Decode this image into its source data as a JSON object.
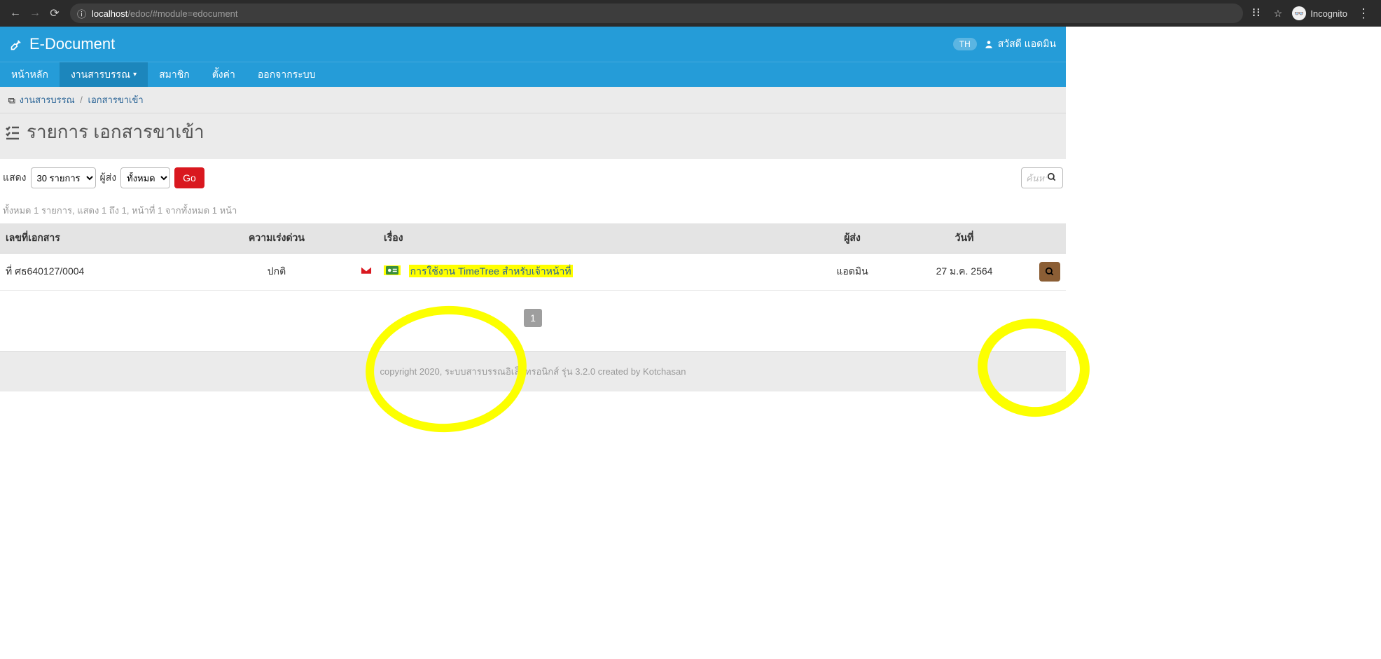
{
  "browser": {
    "url_domain": "localhost",
    "url_path": "/edoc/#module=edocument",
    "incognito_label": "Incognito"
  },
  "topbar": {
    "brand": "E-Document",
    "lang": "TH",
    "greeting": "สวัสดี แอดมิน"
  },
  "nav": {
    "home": "หน้าหลัก",
    "docs": "งานสารบรรณ",
    "member": "สมาชิก",
    "settings": "ตั้งค่า",
    "logout": "ออกจากระบบ"
  },
  "breadcrumb": {
    "a": "งานสารบรรณ",
    "b": "เอกสารขาเข้า"
  },
  "page_title": "รายการ เอกสารขาเข้า",
  "toolbar": {
    "show_label": "แสดง",
    "show_value": "30 รายการ",
    "send_label": "ผู้ส่ง",
    "send_value": "ทั้งหมด",
    "go_label": "Go",
    "search_placeholder": "ค้นหา"
  },
  "summary": "ทั้งหมด 1 รายการ, แสดง 1 ถึง 1, หน้าที่ 1 จากทั้งหมด 1 หน้า",
  "table": {
    "headers": {
      "doc_no": "เลขที่เอกสาร",
      "urgency": "ความเร่งด่วน",
      "icons": "",
      "subject": "เรื่อง",
      "sender": "ผู้ส่ง",
      "date": "วันที่",
      "action": ""
    },
    "row": {
      "doc_no": "ที่ ศธ640127/0004",
      "urgency": "ปกติ",
      "subject": "การใช้งาน TimeTree สำหรับเจ้าหน้าที่",
      "sender": "แอดมิน",
      "date": "27 ม.ค. 2564"
    }
  },
  "pagination": {
    "current": "1"
  },
  "footer": "copyright 2020, ระบบสารบรรณอิเล็กทรอนิกส์ รุ่น 3.2.0 created by Kotchasan"
}
